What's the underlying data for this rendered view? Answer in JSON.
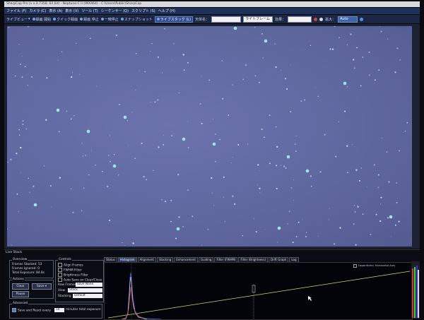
{
  "window": {
    "title": "SharpCap Pro (v x.0.7358, 64 bit) - Neptune-C II (IMX464) - C:\\Users\\Public\\SharpCap"
  },
  "menu": {
    "items": [
      "ファイル (F)",
      "カメラ (C)",
      "表示 (A)",
      "表示 (V)",
      "ツール (T)",
      "シーケンサー (Q)",
      "スクリプト (S)",
      "ヘルプ (H)",
      "ライブスタック (L)"
    ]
  },
  "toolbar": {
    "items": [
      "ライブビュー",
      "録画 開始",
      "クイック録画",
      "録画 停止",
      "一時停止",
      "スナップショット"
    ],
    "live_stack": "ライブスタック (L)",
    "target_label": "天体名：",
    "target_value": "",
    "frame_type": "ライトフレーム",
    "effect_label": "効果：",
    "effect_value": "",
    "zoom_label": "拡大：",
    "zoom_value": "Auto"
  },
  "live_stack": {
    "title": "Live Stack",
    "overview": {
      "label": "Overview",
      "frames_stacked_label": "Frames Stacked:",
      "frames_stacked": "53",
      "frames_ignored_label": "Frames Ignored:",
      "frames_ignored": "0",
      "total_exposure_label": "Total Exposure:",
      "total_exposure": "84.8s"
    },
    "actions": {
      "label": "Actions",
      "clear": "Clear",
      "save": "Save",
      "pause": "Pause"
    },
    "advanced": {
      "label": "Advanced",
      "save_reset": "Save and Reset every",
      "minutes_value": "10",
      "minutes_suffix": "minutes total exposure"
    },
    "controls": {
      "label": "Controls",
      "align": "Align Frames",
      "fwhm": "FWHM Filter",
      "brightness": "Brightness Filter",
      "autosave": "Auto Save on Clear/Close",
      "raw_frames_label": "Raw Frames",
      "raw_frames_value": "Save None",
      "view_label": "View",
      "view_value": "Stack",
      "stacking_label": "Stacking",
      "stacking_value": "Default"
    },
    "tabs": [
      "Status",
      "Histogram",
      "Alignment",
      "Stacking",
      "Enhancement",
      "Guiding",
      "Filter (FWHM)",
      "Filter (Brightness)",
      "Drift Graph",
      "Log"
    ],
    "selected_tab": "Histogram",
    "histogram_options": "Logarithmic Horizontal Axis"
  },
  "colors": {
    "sky": "#5f66a0",
    "star": "#9fe3f0",
    "menu_bg": "#1f3158",
    "accent": "#3b64b0"
  }
}
